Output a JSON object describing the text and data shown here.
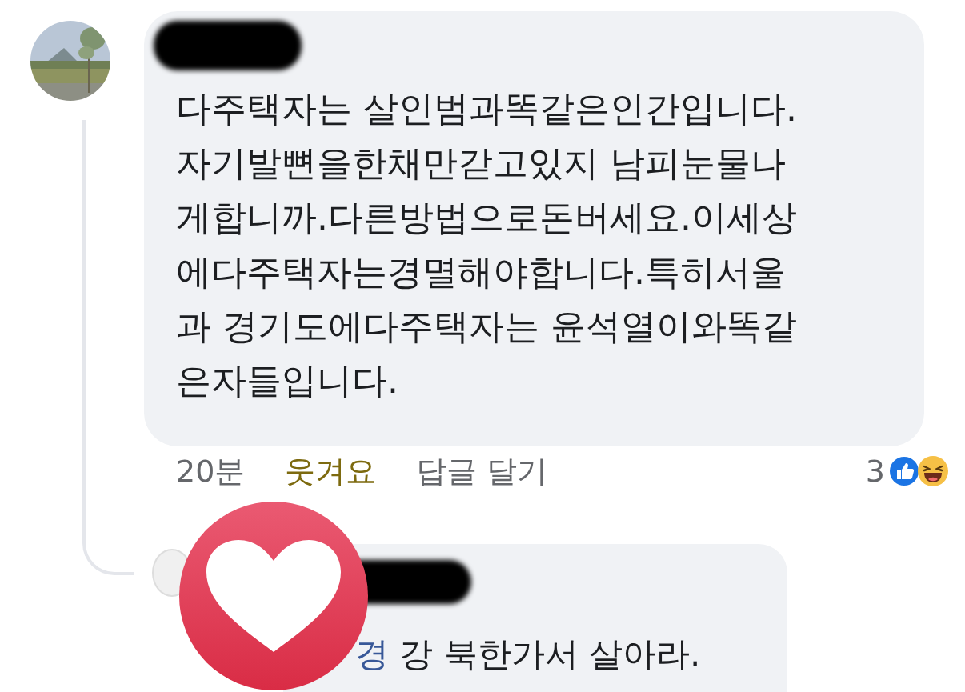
{
  "comment": {
    "text": "다주택자는 살인범과똑같은인간입니다.\n자기발뼌을한채만갇고있지 남피눈물나\n게합니까.다른방법으로돈버세요.이세상\n에다주택자는경멸해야합니다.특히서울\n과 경기도에다주택자는 윤석열이와똑같\n은자들입니다.",
    "time": "20분",
    "reaction_link": {
      "label": "웃겨요",
      "selected": true
    },
    "reply_link": "답글 달기",
    "reaction_count": "3"
  },
  "reply": {
    "mention": "경",
    "text": "강 북한가서 살아라."
  }
}
